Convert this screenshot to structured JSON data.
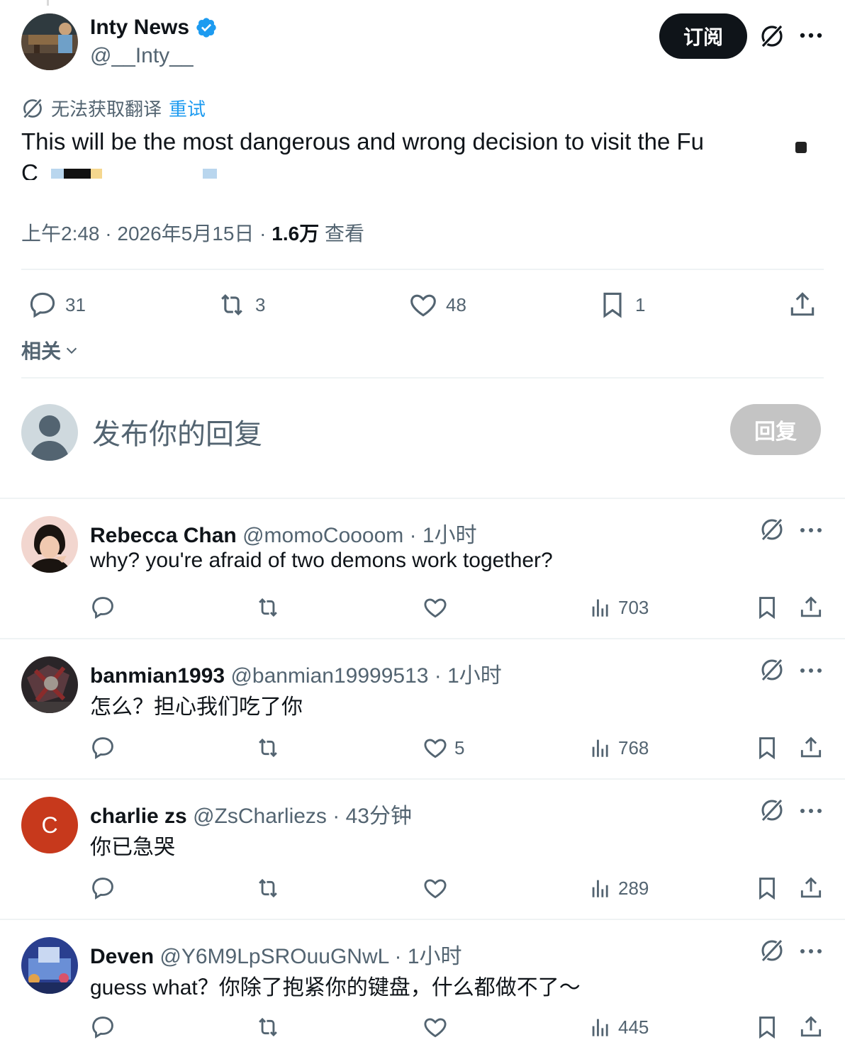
{
  "tweet": {
    "author_name": "Inty News",
    "author_handle": "@__Inty__",
    "subscribe_label": "订阅",
    "translation_error": "无法获取翻译",
    "retry_label": "重试",
    "text": "This will be the most dangerous and wrong  decision to visit the Fu",
    "text_line2": "C",
    "time": "上午2:48 · 2026年5月15日 · ",
    "views_count": "1.6万",
    "views_label": " 查看",
    "stats": {
      "replies": "31",
      "retweets": "3",
      "likes": "48",
      "bookmarks": "1"
    },
    "related_label": "相关"
  },
  "composer": {
    "placeholder": "发布你的回复",
    "reply_button": "回复"
  },
  "replies": [
    {
      "name": "Rebecca Chan",
      "handle": "@momoCoooom",
      "time": " · 1小时",
      "text": "why?  you're afraid of two demons work together?",
      "likes": "",
      "views": "703"
    },
    {
      "name": "banmian1993",
      "handle": "@banmian19999513",
      "time": " · 1小时",
      "text": "怎么？担心我们吃了你",
      "likes": "5",
      "views": "768"
    },
    {
      "name": "charlie zs",
      "handle": "@ZsCharliezs",
      "time": " · 43分钟",
      "text": "你已急哭",
      "likes": "",
      "views": "289",
      "avatar_letter": "C"
    },
    {
      "name": "Deven",
      "handle": "@Y6M9LpSROuuGNwL",
      "time": " · 1小时",
      "text": "guess what？你除了抱紧你的键盘，什么都做不了～",
      "likes": "",
      "views": "445"
    }
  ],
  "colors": {
    "accent": "#1d9bf0",
    "verified": "#1d9bf0",
    "muted": "#536471",
    "charlie_avatar": "#c7391c"
  }
}
